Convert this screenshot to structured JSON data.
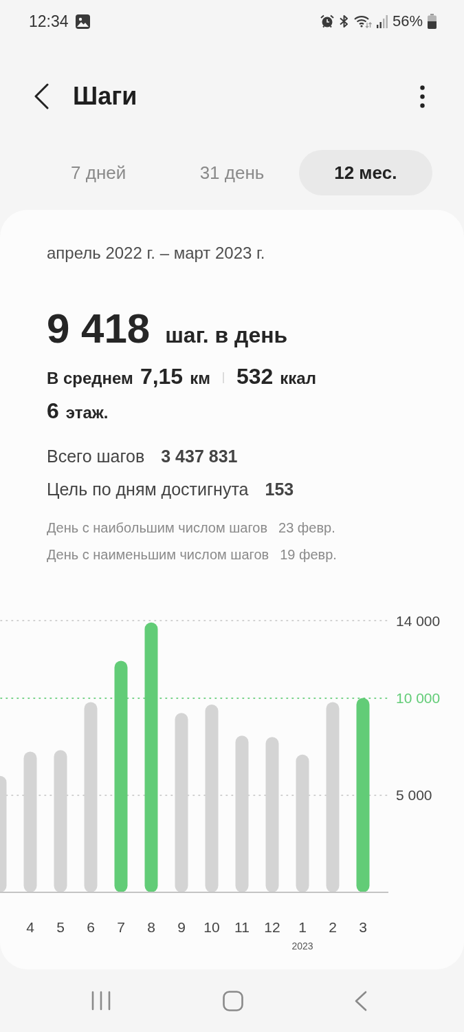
{
  "status_bar": {
    "time": "12:34",
    "battery": "56%"
  },
  "header": {
    "title": "Шаги"
  },
  "tabs": [
    {
      "label": "7 дней",
      "selected": false
    },
    {
      "label": "31 день",
      "selected": false
    },
    {
      "label": "12 мес.",
      "selected": true
    }
  ],
  "summary": {
    "period": "апрель 2022 г. – март 2023 г.",
    "daily_average": {
      "value": "9 418",
      "unit": "шаг. в день"
    },
    "average_label": "В среднем",
    "metrics": [
      {
        "value": "7,15",
        "unit": "км"
      },
      {
        "value": "532",
        "unit": "ккал"
      },
      {
        "value": "6",
        "unit": "этаж."
      }
    ]
  },
  "stats": [
    {
      "label": "Всего шагов",
      "value": "3 437 831"
    },
    {
      "label": "Цель по дням достигнута",
      "value": "153"
    }
  ],
  "records": [
    {
      "label": "День с наибольшим числом шагов",
      "value": "23 февр."
    },
    {
      "label": "День с наименьшим числом шагов",
      "value": "19 февр."
    }
  ],
  "chart": {
    "chart_data": {
      "type": "bar",
      "categories": [
        null,
        "4",
        "5",
        "6",
        "7",
        "8",
        "9",
        "10",
        "11",
        "12",
        "1",
        "2",
        "3"
      ],
      "series": [
        {
          "color": "#d4d4d4",
          "values": [
            6000,
            7250,
            7330,
            9800,
            null,
            null,
            9240,
            9680,
            8070,
            8000,
            7100,
            9800,
            null
          ]
        },
        {
          "color": "#62cc77",
          "values": [
            null,
            null,
            null,
            null,
            11930,
            13900,
            null,
            null,
            null,
            null,
            null,
            null,
            10010
          ]
        }
      ],
      "ylim": [
        0,
        14000
      ],
      "yticks": [
        {
          "value": 5000,
          "label": "5 000"
        },
        {
          "value": 14000,
          "label": "14 000"
        }
      ],
      "ref_lines": [
        {
          "axis": "y",
          "value": 5000,
          "color": "#c2c2c2"
        },
        {
          "axis": "y",
          "value": 10000,
          "color": "#62cc77",
          "label": "10 000"
        }
      ],
      "annotations": [
        "2023"
      ]
    }
  }
}
